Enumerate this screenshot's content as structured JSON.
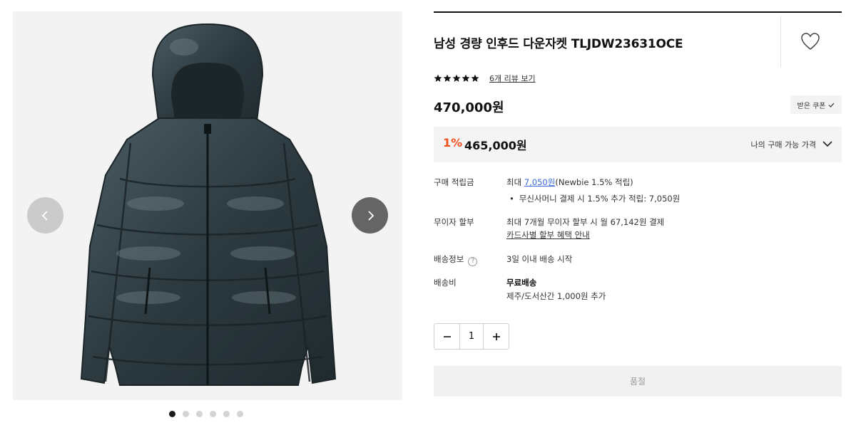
{
  "product": {
    "title": "남성 경량 인후드 다운자켓 TLJDW23631OCE",
    "rating_stars": 5,
    "review_link": "6개 리뷰 보기",
    "price": "470,000원",
    "coupon_button": "받은 쿠폰"
  },
  "my_price": {
    "discount_rate": "1%",
    "price": "465,000원",
    "label": "나의 구매 가능 가격"
  },
  "details": {
    "points": {
      "label": "구매 적립금",
      "prefix": "최대 ",
      "amount": "7,050원",
      "suffix": "(Newbie 1.5% 적립)",
      "bullet": "무신사머니 결제 시 1.5% 추가 적립: 7,050원"
    },
    "installment": {
      "label": "무이자 할부",
      "value": "최대 7개월 무이자 할부 시 월 67,142원 결제",
      "link": "카드사별 할부 혜택 안내"
    },
    "shipping_info": {
      "label": "배송정보",
      "help": "?",
      "value": "3일 이내 배송 시작"
    },
    "shipping_fee": {
      "label": "배송비",
      "value": "무료배송",
      "note": "제주/도서산간 1,000원 추가"
    }
  },
  "quantity": {
    "minus": "−",
    "value": "1",
    "plus": "+"
  },
  "soldout_button": "품절",
  "gallery": {
    "image_count": 6,
    "active_index": 0
  },
  "icons": {
    "prev": "chevron-left-icon",
    "next": "chevron-right-icon",
    "favorite": "heart-icon",
    "dropdown": "chevron-down-icon"
  },
  "colors": {
    "accent": "#f0501e",
    "link": "#3c6ad8",
    "jacket": "#2f3d43"
  }
}
